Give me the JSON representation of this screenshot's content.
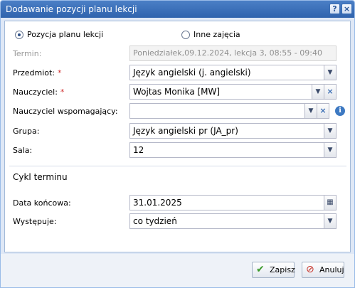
{
  "window": {
    "title": "Dodawanie pozycji planu lekcji"
  },
  "type_choice": {
    "option_lesson": "Pozycja planu lekcji",
    "option_other": "Inne zajęcia",
    "selected": "Pozycja planu lekcji"
  },
  "fields": {
    "termin": {
      "label": "Termin:",
      "value": "Poniedziałek,09.12.2024, lekcja 3, 08:55 - 09:40"
    },
    "przedmiot": {
      "label": "Przedmiot:",
      "required": "*",
      "value": "Język angielski (j. angielski)"
    },
    "nauczyciel": {
      "label": "Nauczyciel:",
      "required": "*",
      "value": "Wojtas Monika [MW]"
    },
    "nauczyciel_wspomagajacy": {
      "label": "Nauczyciel wspomagający:",
      "value": ""
    },
    "grupa": {
      "label": "Grupa:",
      "value": "Język angielski pr (JA_pr)"
    },
    "sala": {
      "label": "Sala:",
      "value": "12"
    }
  },
  "cykl": {
    "heading": "Cykl terminu",
    "data_koncowa": {
      "label": "Data końcowa:",
      "value": "31.01.2025"
    },
    "wystepuje": {
      "label": "Występuje:",
      "value": "co tydzień"
    }
  },
  "buttons": {
    "save": "Zapisz",
    "cancel": "Anuluj"
  },
  "icons": {
    "help": "help-icon",
    "close": "close-icon",
    "dropdown": "chevron-down-icon",
    "clear": "clear-icon",
    "info": "info-icon",
    "calendar": "calendar-icon",
    "save": "check-icon",
    "cancel": "cancel-icon"
  },
  "colors": {
    "titlebar": "#2f63ad",
    "required": "#d03030",
    "info": "#3d79c2"
  }
}
